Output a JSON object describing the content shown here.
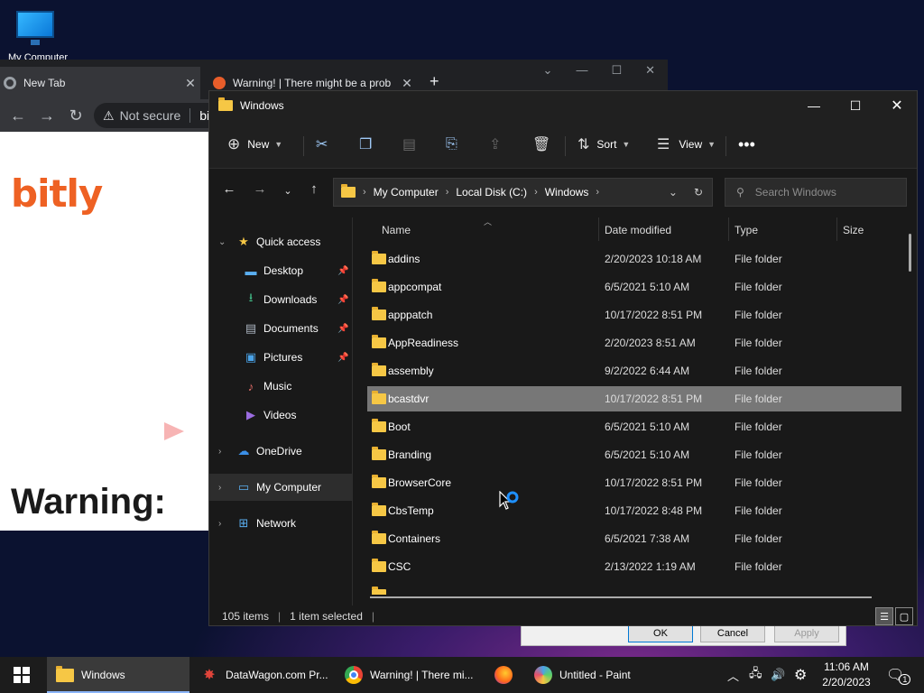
{
  "desktop": {
    "icon_label": "My Computer"
  },
  "chrome": {
    "tabs": [
      {
        "title": "New Tab"
      },
      {
        "title": "Warning! | There might be a prob"
      }
    ],
    "security_label": "Not secure",
    "url": "bit.ly",
    "page_logo": "bitly",
    "page_heading": "Warning:"
  },
  "dialog": {
    "ok": "OK",
    "cancel": "Cancel",
    "apply": "Apply"
  },
  "explorer": {
    "title": "Windows",
    "toolbar": {
      "new_label": "New",
      "sort_label": "Sort",
      "view_label": "View"
    },
    "breadcrumb": [
      "My Computer",
      "Local Disk (C:)",
      "Windows"
    ],
    "search_placeholder": "Search Windows",
    "nav": {
      "quick_access": "Quick access",
      "items": [
        {
          "label": "Desktop",
          "icon": "desktop-icon"
        },
        {
          "label": "Downloads",
          "icon": "download-icon"
        },
        {
          "label": "Documents",
          "icon": "document-icon"
        },
        {
          "label": "Pictures",
          "icon": "picture-icon"
        },
        {
          "label": "Music",
          "icon": "music-icon"
        },
        {
          "label": "Videos",
          "icon": "video-icon"
        }
      ],
      "onedrive": "OneDrive",
      "my_computer": "My Computer",
      "network": "Network"
    },
    "columns": {
      "name": "Name",
      "date": "Date modified",
      "type": "Type",
      "size": "Size"
    },
    "files": [
      {
        "name": "addins",
        "date": "2/20/2023 10:18 AM",
        "type": "File folder"
      },
      {
        "name": "appcompat",
        "date": "6/5/2021 5:10 AM",
        "type": "File folder"
      },
      {
        "name": "apppatch",
        "date": "10/17/2022 8:51 PM",
        "type": "File folder"
      },
      {
        "name": "AppReadiness",
        "date": "2/20/2023 8:51 AM",
        "type": "File folder"
      },
      {
        "name": "assembly",
        "date": "9/2/2022 6:44 AM",
        "type": "File folder"
      },
      {
        "name": "bcastdvr",
        "date": "10/17/2022 8:51 PM",
        "type": "File folder",
        "selected": true
      },
      {
        "name": "Boot",
        "date": "6/5/2021 5:10 AM",
        "type": "File folder"
      },
      {
        "name": "Branding",
        "date": "6/5/2021 5:10 AM",
        "type": "File folder"
      },
      {
        "name": "BrowserCore",
        "date": "10/17/2022 8:51 PM",
        "type": "File folder"
      },
      {
        "name": "CbsTemp",
        "date": "10/17/2022 8:48 PM",
        "type": "File folder"
      },
      {
        "name": "Containers",
        "date": "6/5/2021 7:38 AM",
        "type": "File folder"
      },
      {
        "name": "CSC",
        "date": "2/13/2022 1:19 AM",
        "type": "File folder"
      }
    ],
    "status": {
      "count": "105 items",
      "selection": "1 item selected"
    }
  },
  "taskbar": {
    "items": [
      {
        "label": "Windows",
        "icon": "folder-icon"
      },
      {
        "label": "DataWagon.com Pr...",
        "icon": "datawagon-icon"
      },
      {
        "label": "Warning! | There mi...",
        "icon": "chrome-icon"
      },
      {
        "label": "",
        "icon": "firefox-icon"
      },
      {
        "label": "Untitled - Paint",
        "icon": "paint-icon"
      }
    ],
    "time": "11:06 AM",
    "date": "2/20/2023",
    "notification_count": "1"
  },
  "colors": {
    "accent": "#0078d4",
    "folder": "#f6c745",
    "selection": "#777777",
    "bitly": "#ee6123"
  }
}
